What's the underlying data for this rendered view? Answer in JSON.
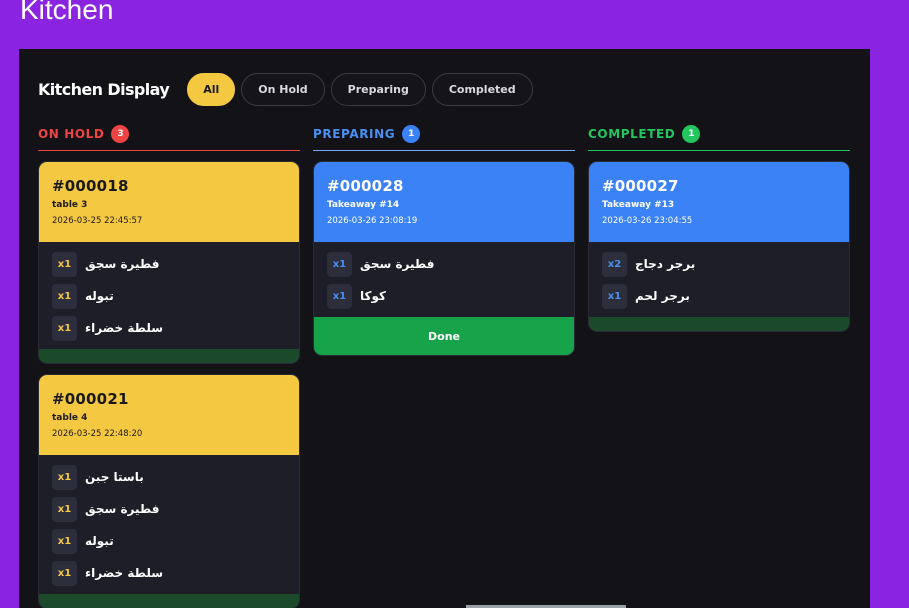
{
  "page": {
    "title": "Kitchen"
  },
  "app": {
    "brand": "Kitchen Display",
    "filters": [
      {
        "label": "All",
        "active": true
      },
      {
        "label": "On Hold"
      },
      {
        "label": "Preparing"
      },
      {
        "label": "Completed"
      }
    ]
  },
  "columns": {
    "on_hold": {
      "title": "ON HOLD",
      "count": "3",
      "color": "#ef4444",
      "orders": [
        {
          "id": "#000018",
          "sub": "table 3",
          "time": "2026-03-25 22:45:57",
          "items": [
            {
              "qty": "x1",
              "name": "فطيرة سجق"
            },
            {
              "qty": "x1",
              "name": "تبوله"
            },
            {
              "qty": "x1",
              "name": "سلطة خضراء"
            }
          ]
        },
        {
          "id": "#000021",
          "sub": "table 4",
          "time": "2026-03-25 22:48:20",
          "items": [
            {
              "qty": "x1",
              "name": "باستا جبن"
            },
            {
              "qty": "x1",
              "name": "فطيرة سجق"
            },
            {
              "qty": "x1",
              "name": "تبوله"
            },
            {
              "qty": "x1",
              "name": "سلطة خضراء"
            }
          ]
        }
      ]
    },
    "preparing": {
      "title": "PREPARING",
      "count": "1",
      "color": "#3b82f6",
      "orders": [
        {
          "id": "#000028",
          "sub": "Takeaway #14",
          "time": "2026-03-26 23:08:19",
          "items": [
            {
              "qty": "x1",
              "name": "فطيرة سجق"
            },
            {
              "qty": "x1",
              "name": "كوكا"
            }
          ],
          "action": "Done"
        }
      ]
    },
    "completed": {
      "title": "COMPLETED",
      "count": "1",
      "color": "#22c55e",
      "orders": [
        {
          "id": "#000027",
          "sub": "Takeaway #13",
          "time": "2026-03-26 23:04:55",
          "items": [
            {
              "qty": "x2",
              "name": "برجر دجاج"
            },
            {
              "qty": "x1",
              "name": "برجر لحم"
            }
          ]
        }
      ]
    }
  }
}
